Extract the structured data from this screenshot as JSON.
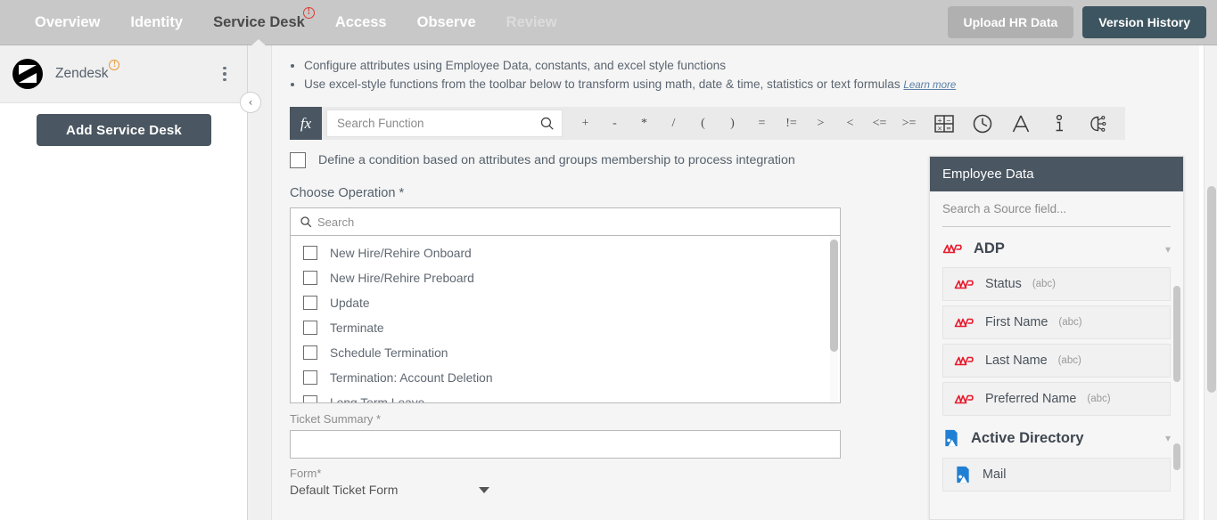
{
  "topnav": {
    "items": [
      {
        "label": "Overview",
        "state": "normal"
      },
      {
        "label": "Identity",
        "state": "normal"
      },
      {
        "label": "Service Desk",
        "state": "active",
        "badge": "!"
      },
      {
        "label": "Access",
        "state": "normal"
      },
      {
        "label": "Observe",
        "state": "normal"
      },
      {
        "label": "Review",
        "state": "dim"
      }
    ],
    "upload_label": "Upload HR Data",
    "version_label": "Version History",
    "bg_color": "#c8c8c8",
    "version_color": "#3d5560"
  },
  "sidebar": {
    "connector_name": "Zendesk",
    "connector_badge": "!",
    "add_button_label": "Add Service Desk",
    "collapse_icon": "‹"
  },
  "tips": {
    "line1": "Configure attributes using Employee Data, constants, and excel style functions",
    "line2": "Use excel-style functions from the toolbar below to transform using math, date & time, statistics or text formulas",
    "learn_more": "Learn more"
  },
  "formula_bar": {
    "fx_label": "fx",
    "search_placeholder": "Search Function",
    "search_value": "",
    "operators": [
      "+",
      "-",
      "*",
      "/",
      "(",
      ")",
      "=",
      "!=",
      ">",
      "<",
      "<=",
      ">="
    ],
    "tool_icons": [
      "calculator-icon",
      "clock-icon",
      "text-icon",
      "info-icon",
      "ai-brain-icon"
    ]
  },
  "form": {
    "condition_label": "Define a condition based on attributes and groups membership to process integration",
    "condition_checked": false,
    "choose_operation_label": "Choose Operation *",
    "operation_search_placeholder": "Search",
    "operation_search_value": "",
    "operations": [
      {
        "label": "New Hire/Rehire Onboard",
        "checked": false
      },
      {
        "label": "New Hire/Rehire Preboard",
        "checked": false
      },
      {
        "label": "Update",
        "checked": false
      },
      {
        "label": "Terminate",
        "checked": false
      },
      {
        "label": "Schedule Termination",
        "checked": false
      },
      {
        "label": "Termination: Account Deletion",
        "checked": false
      },
      {
        "label": "Long Term Leave",
        "checked": false
      }
    ],
    "ticket_summary_label": "Ticket Summary *",
    "ticket_summary_value": "",
    "form_label": "Form*",
    "form_value": "Default Ticket Form"
  },
  "employee_data": {
    "title": "Employee Data",
    "search_placeholder": "Search a Source field...",
    "search_value": "",
    "groups": [
      {
        "name": "ADP",
        "icon": "adp-icon",
        "expanded": true,
        "fields": [
          {
            "name": "Status",
            "type": "(abc)"
          },
          {
            "name": "First Name",
            "type": "(abc)"
          },
          {
            "name": "Last Name",
            "type": "(abc)"
          },
          {
            "name": "Preferred Name",
            "type": "(abc)"
          }
        ]
      },
      {
        "name": "Active Directory",
        "icon": "active-directory-icon",
        "expanded": true,
        "fields": [
          {
            "name": "Mail",
            "type": ""
          }
        ]
      }
    ],
    "header_color": "#4a5661"
  }
}
